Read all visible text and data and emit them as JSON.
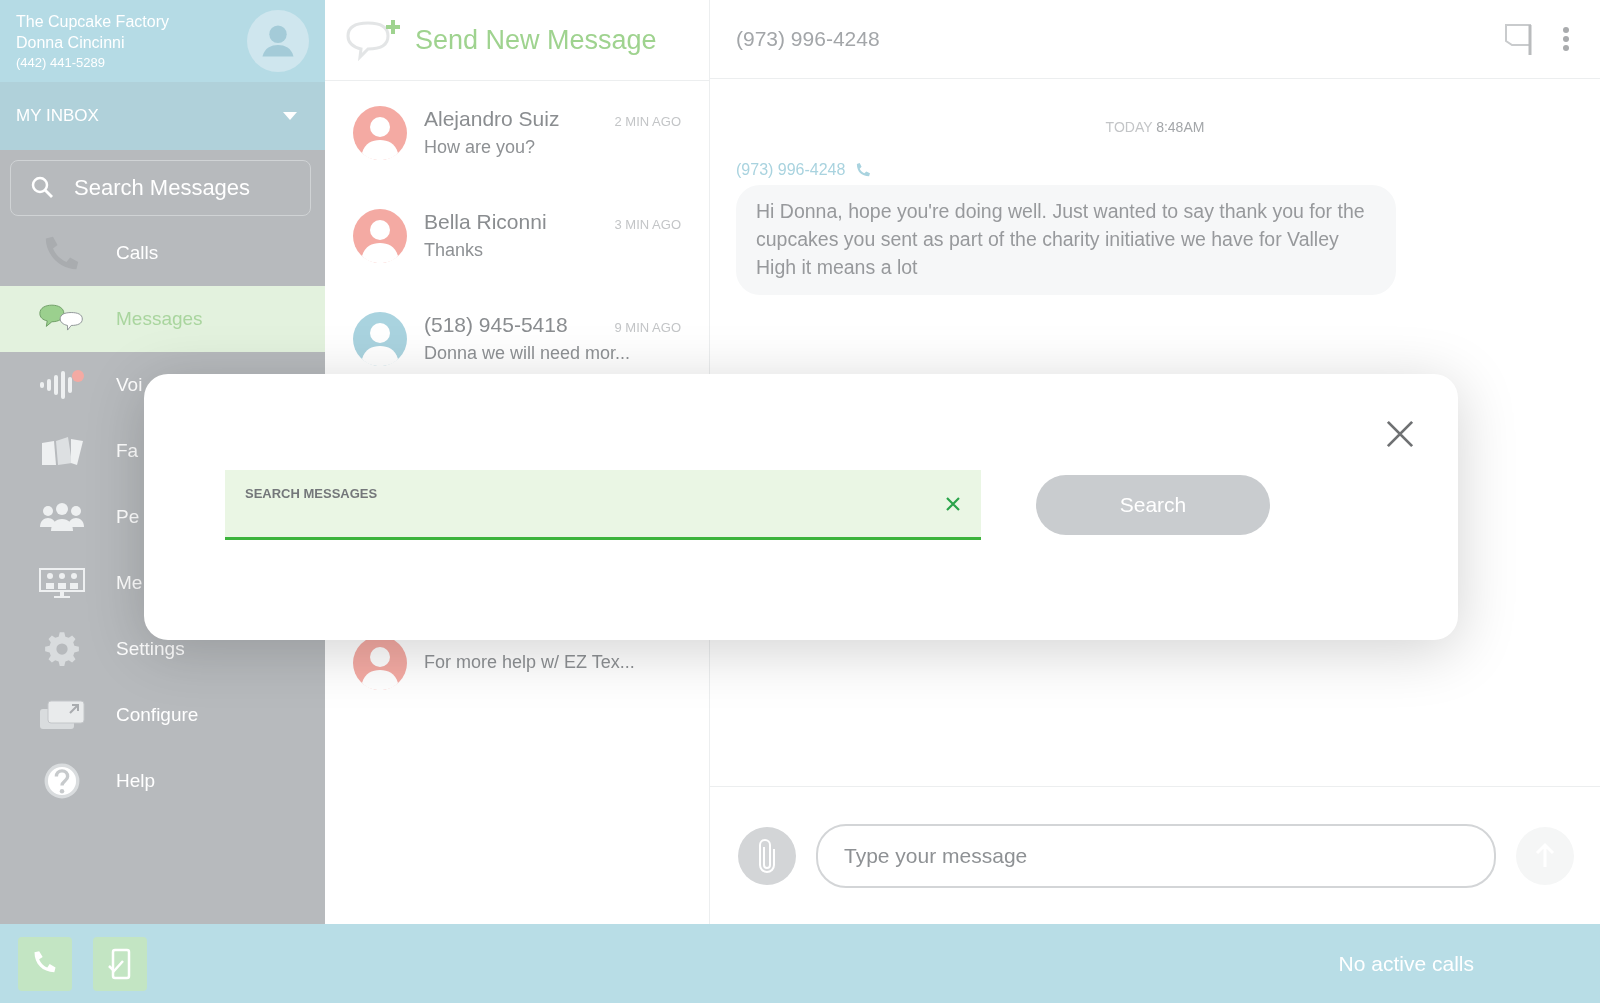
{
  "account": {
    "company": "The Cupcake Factory",
    "user": "Donna Cincinni",
    "phone": "(442) 441-5289"
  },
  "inbox": {
    "label": "MY INBOX"
  },
  "sidebar_search": {
    "placeholder": "Search Messages"
  },
  "nav": [
    {
      "label": "Calls",
      "selected": false
    },
    {
      "label": "Messages",
      "selected": true
    },
    {
      "label": "Voi",
      "selected": false
    },
    {
      "label": "Fa",
      "selected": false
    },
    {
      "label": "Pe",
      "selected": false
    },
    {
      "label": "Me",
      "selected": false
    },
    {
      "label": "Settings",
      "selected": false
    },
    {
      "label": "Configure",
      "selected": false
    },
    {
      "label": "Help",
      "selected": false
    }
  ],
  "compose": {
    "label": "Send New Message"
  },
  "conversations": [
    {
      "name": "Alejandro Suiz",
      "time": "2 MIN AGO",
      "preview": "How are you?",
      "color": "#f4aaa3"
    },
    {
      "name": "Bella Riconni",
      "time": "3 MIN AGO",
      "preview": "Thanks",
      "color": "#f4aaa3"
    },
    {
      "name": "(518) 945-5418",
      "time": "9 MIN AGO",
      "preview": "Donna we will need mor...",
      "color": "#a9d3df"
    },
    {
      "preview": "For more help w/ EZ Tex...",
      "color": "#f4aaa3"
    }
  ],
  "thread": {
    "title": "(973) 996-4248",
    "day": "TODAY",
    "time": "8:48AM",
    "sender": "(973) 996-4248",
    "message": "Hi Donna, hope you're doing well. Just wanted to say thank you for the cupcakes you sent as part of the charity initiative we have for Valley High it means a lot"
  },
  "composer": {
    "placeholder": "Type your message"
  },
  "status_bar": {
    "text": "No active calls"
  },
  "modal": {
    "field_label": "SEARCH MESSAGES",
    "button": "Search"
  }
}
